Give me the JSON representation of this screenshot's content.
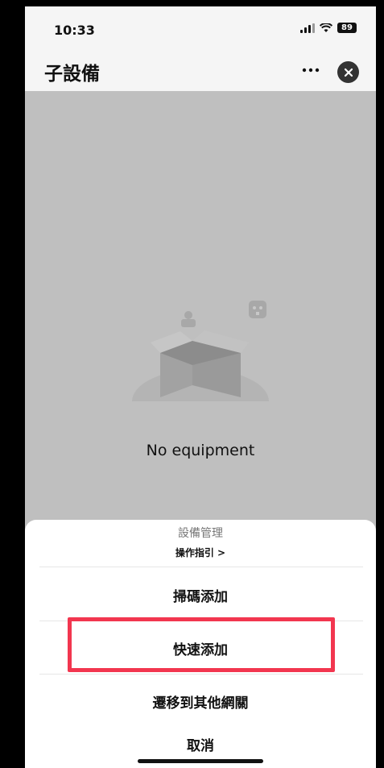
{
  "status_bar": {
    "time": "10:33",
    "battery": "89"
  },
  "header": {
    "title": "子設備"
  },
  "empty_state": {
    "text": "No equipment"
  },
  "action_sheet": {
    "title": "設備管理",
    "guide_link": "操作指引 >",
    "options": [
      {
        "label": "掃碼添加"
      },
      {
        "label": "快速添加"
      },
      {
        "label": "遷移到其他網關"
      }
    ],
    "cancel_label": "取消"
  },
  "colors": {
    "highlight": "#f2364f",
    "backdrop": "#bfbfbf"
  }
}
